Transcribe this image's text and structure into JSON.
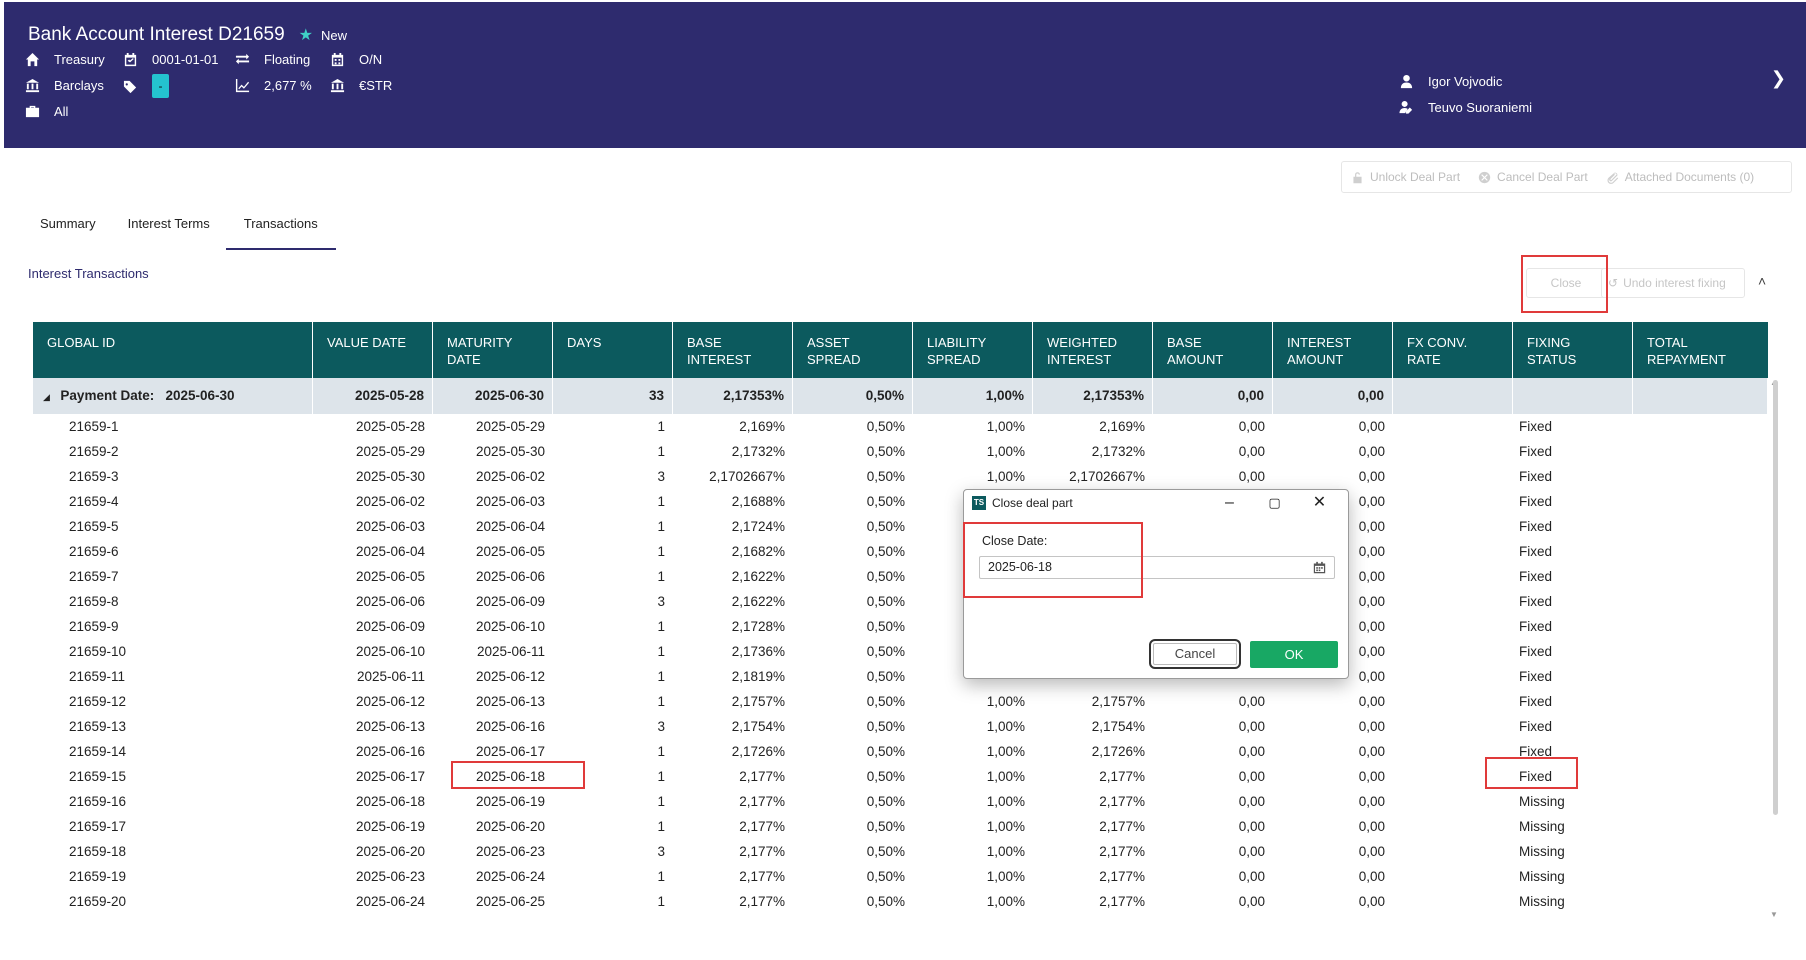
{
  "header": {
    "title": "Bank Account Interest D21659",
    "status": "New",
    "info": {
      "portfolio": "Treasury",
      "date": "0001-01-01",
      "rate_type": "Floating",
      "tenor": "O/N",
      "bank": "Barclays",
      "tag": "-",
      "rate": "2,677 %",
      "index": "€STR",
      "scope": "All"
    },
    "users": [
      "Igor Vojvodic",
      "Teuvo Suoraniemi"
    ]
  },
  "top_actions": [
    "Unlock Deal Part",
    "Cancel Deal Part",
    "Attached Documents (0)"
  ],
  "tabs": [
    "Summary",
    "Interest Terms",
    "Transactions"
  ],
  "active_tab": "Transactions",
  "section_title": "Interest Transactions",
  "section_actions": {
    "close": "Close",
    "undo": "Undo interest fixing"
  },
  "table": {
    "columns": [
      "GLOBAL ID",
      "VALUE DATE",
      "MATURITY DATE",
      "DAYS",
      "BASE INTEREST",
      "ASSET SPREAD",
      "LIABILITY SPREAD",
      "WEIGHTED INTEREST",
      "BASE AMOUNT",
      "INTEREST AMOUNT",
      "FX CONV. RATE",
      "FIXING STATUS",
      "TOTAL REPAYMENT"
    ],
    "group": {
      "label": "Payment Date:",
      "date": "2025-06-30",
      "value_date": "2025-05-28",
      "maturity_date": "2025-06-30",
      "days": "33",
      "base_interest": "2,17353%",
      "asset_spread": "0,50%",
      "liability_spread": "1,00%",
      "weighted_interest": "2,17353%",
      "base_amount": "0,00",
      "interest_amount": "0,00"
    },
    "rows": [
      [
        "21659-1",
        "2025-05-28",
        "2025-05-29",
        "1",
        "2,169%",
        "0,50%",
        "1,00%",
        "2,169%",
        "0,00",
        "0,00",
        "Fixed"
      ],
      [
        "21659-2",
        "2025-05-29",
        "2025-05-30",
        "1",
        "2,1732%",
        "0,50%",
        "1,00%",
        "2,1732%",
        "0,00",
        "0,00",
        "Fixed"
      ],
      [
        "21659-3",
        "2025-05-30",
        "2025-06-02",
        "3",
        "2,1702667%",
        "0,50%",
        "1,00%",
        "2,1702667%",
        "0,00",
        "0,00",
        "Fixed"
      ],
      [
        "21659-4",
        "2025-06-02",
        "2025-06-03",
        "1",
        "2,1688%",
        "0,50%",
        "",
        "",
        "",
        "0,00",
        "Fixed"
      ],
      [
        "21659-5",
        "2025-06-03",
        "2025-06-04",
        "1",
        "2,1724%",
        "0,50%",
        "",
        "",
        "",
        "0,00",
        "Fixed"
      ],
      [
        "21659-6",
        "2025-06-04",
        "2025-06-05",
        "1",
        "2,1682%",
        "0,50%",
        "",
        "",
        "",
        "0,00",
        "Fixed"
      ],
      [
        "21659-7",
        "2025-06-05",
        "2025-06-06",
        "1",
        "2,1622%",
        "0,50%",
        "",
        "",
        "",
        "0,00",
        "Fixed"
      ],
      [
        "21659-8",
        "2025-06-06",
        "2025-06-09",
        "3",
        "2,1622%",
        "0,50%",
        "",
        "",
        "",
        "0,00",
        "Fixed"
      ],
      [
        "21659-9",
        "2025-06-09",
        "2025-06-10",
        "1",
        "2,1728%",
        "0,50%",
        "",
        "",
        "",
        "0,00",
        "Fixed"
      ],
      [
        "21659-10",
        "2025-06-10",
        "2025-06-11",
        "1",
        "2,1736%",
        "0,50%",
        "",
        "",
        "",
        "0,00",
        "Fixed"
      ],
      [
        "21659-11",
        "2025-06-11",
        "2025-06-12",
        "1",
        "2,1819%",
        "0,50%",
        "",
        "",
        "",
        "0,00",
        "Fixed"
      ],
      [
        "21659-12",
        "2025-06-12",
        "2025-06-13",
        "1",
        "2,1757%",
        "0,50%",
        "1,00%",
        "2,1757%",
        "0,00",
        "0,00",
        "Fixed"
      ],
      [
        "21659-13",
        "2025-06-13",
        "2025-06-16",
        "3",
        "2,1754%",
        "0,50%",
        "1,00%",
        "2,1754%",
        "0,00",
        "0,00",
        "Fixed"
      ],
      [
        "21659-14",
        "2025-06-16",
        "2025-06-17",
        "1",
        "2,1726%",
        "0,50%",
        "1,00%",
        "2,1726%",
        "0,00",
        "0,00",
        "Fixed"
      ],
      [
        "21659-15",
        "2025-06-17",
        "2025-06-18",
        "1",
        "2,177%",
        "0,50%",
        "1,00%",
        "2,177%",
        "0,00",
        "0,00",
        "Fixed"
      ],
      [
        "21659-16",
        "2025-06-18",
        "2025-06-19",
        "1",
        "2,177%",
        "0,50%",
        "1,00%",
        "2,177%",
        "0,00",
        "0,00",
        "Missing"
      ],
      [
        "21659-17",
        "2025-06-19",
        "2025-06-20",
        "1",
        "2,177%",
        "0,50%",
        "1,00%",
        "2,177%",
        "0,00",
        "0,00",
        "Missing"
      ],
      [
        "21659-18",
        "2025-06-20",
        "2025-06-23",
        "3",
        "2,177%",
        "0,50%",
        "1,00%",
        "2,177%",
        "0,00",
        "0,00",
        "Missing"
      ],
      [
        "21659-19",
        "2025-06-23",
        "2025-06-24",
        "1",
        "2,177%",
        "0,50%",
        "1,00%",
        "2,177%",
        "0,00",
        "0,00",
        "Missing"
      ],
      [
        "21659-20",
        "2025-06-24",
        "2025-06-25",
        "1",
        "2,177%",
        "0,50%",
        "1,00%",
        "2,177%",
        "0,00",
        "0,00",
        "Missing"
      ]
    ]
  },
  "dialog": {
    "title": "Close deal part",
    "logo_text": "TS",
    "label": "Close Date:",
    "value": "2025-06-18",
    "cancel": "Cancel",
    "ok": "OK"
  },
  "colors": {
    "header_bg": "#2e2b6e",
    "table_header_bg": "#0c5a5e",
    "group_row_bg": "#dde4ea",
    "ok_button": "#18a864",
    "highlight": "#e03a3a"
  }
}
